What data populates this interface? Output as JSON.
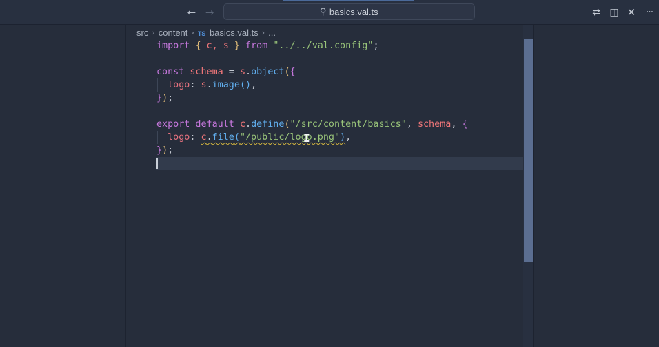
{
  "titlebar": {
    "search_text": "basics.val.ts",
    "icons": {
      "back": "arrow-left-icon",
      "forward": "arrow-right-icon",
      "search": "search-icon",
      "diff": "compare-changes-icon",
      "split": "split-editor-icon",
      "close": "close-icon",
      "more": "more-actions-icon"
    }
  },
  "breadcrumb": {
    "items": [
      "src",
      "content"
    ],
    "file_badge": "TS",
    "file": "basics.val.ts",
    "trailing": "..."
  },
  "colors": {
    "keyword": "#c678dd",
    "variable": "#ef7679",
    "function": "#61afef",
    "string": "#98c379",
    "warning_squiggle": "#d7b83e",
    "scroll_thumb": "#5b6e91"
  },
  "code": {
    "l1": {
      "import": "import",
      "ob": "{",
      "c": " c, s ",
      "cb": "}",
      "from": " from ",
      "str": "\"../../val.config\"",
      "semi": ";"
    },
    "l3": {
      "const": "const",
      "name": " schema",
      "eq": " = ",
      "s": "s",
      "dot": ".",
      "fn": "object",
      "op": "(",
      "ob": "{"
    },
    "l4": {
      "prop": "logo",
      "colon": ": ",
      "s": "s",
      "dot": ".",
      "fn": "image",
      "parens": "()",
      "comma": ","
    },
    "l5": {
      "cb": "}",
      "cp": ")",
      "semi": ";"
    },
    "l7": {
      "export": "export",
      "default": " default ",
      "c": "c",
      "dot": ".",
      "fn": "define",
      "op": "(",
      "str": "\"/src/content/basics\"",
      "comma": ", ",
      "schema": "schema",
      "comma2": ", ",
      "ob": "{"
    },
    "l8": {
      "prop": "logo",
      "colon": ": ",
      "c": "c",
      "dot": ".",
      "fn": "file",
      "op": "(",
      "str": "\"/public/logo.png\"",
      "cp": ")",
      "comma": ","
    },
    "l9": {
      "cb": "}",
      "cp": ")",
      "semi": ";"
    }
  }
}
